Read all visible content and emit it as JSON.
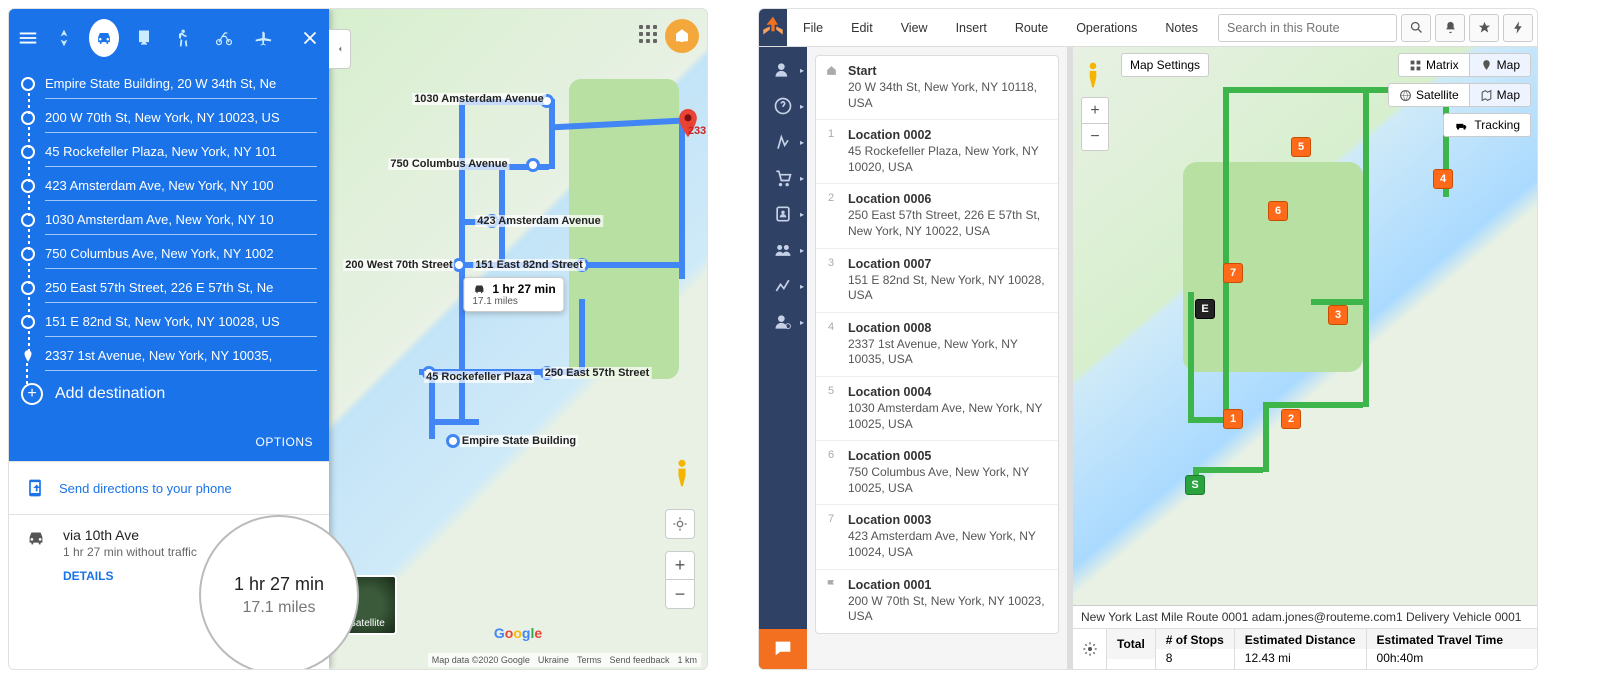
{
  "left_app": {
    "header_modes": [
      "best",
      "car",
      "transit",
      "walk",
      "bike",
      "plane"
    ],
    "active_mode": "car",
    "stops": [
      "Empire State Building, 20 W 34th St, Ne",
      "200 W 70th St, New York, NY 10023, US",
      "45 Rockefeller Plaza, New York, NY 101",
      "423 Amsterdam Ave, New York, NY 100",
      "1030 Amsterdam Ave, New York, NY 10",
      "750 Columbus Ave, New York, NY 1002",
      "250 East 57th Street, 226 E 57th St, Ne",
      "151 E 82nd St, New York, NY 10028, US",
      "2337 1st Avenue, New York, NY 10035,"
    ],
    "add_destination_label": "Add destination",
    "options_label": "OPTIONS",
    "send_label": "Send directions to your phone",
    "route_summary": {
      "via": "via 10th Ave",
      "sub": "1 hr 27 min without traffic",
      "details_label": "DETAILS",
      "time": "1 hr 27 min",
      "distance": "17.1 miles"
    },
    "map_labels": {
      "m1": "1030 Amsterdam Avenue",
      "m2": "750 Columbus Avenue",
      "m3": "423 Amsterdam Avenue",
      "m4": "200 West 70th Street",
      "m5": "151 East 82nd Street",
      "m6": "45 Rockefeller Plaza",
      "m7": "250 East 57th Street",
      "m8": "Empire State Building",
      "dest": "233",
      "tooltip_time": "1 hr 27 min",
      "tooltip_dist": "17.1 miles"
    },
    "satellite_label": "Satellite",
    "attribution": [
      "Map data ©2020 Google",
      "Ukraine",
      "Terms",
      "Send feedback",
      "1 km"
    ],
    "magnify_time": "1 hr 27 min",
    "magnify_dist": "17.1 miles"
  },
  "right_app": {
    "menu": [
      "File",
      "Edit",
      "View",
      "Insert",
      "Route",
      "Operations",
      "Notes"
    ],
    "search_placeholder": "Search in this Route",
    "map_settings_label": "Map Settings",
    "view_toggle": {
      "matrix": "Matrix",
      "map": "Map",
      "active": "map"
    },
    "layer_toggle": {
      "satellite": "Satellite",
      "map": "Map",
      "active": "map"
    },
    "tracking_label": "Tracking",
    "stops": [
      {
        "num": "",
        "icon": "home",
        "title": "Start",
        "addr": "20 W 34th St, New York, NY 10118, USA"
      },
      {
        "num": "1",
        "title": "Location 0002",
        "addr": "45 Rockefeller Plaza, New York, NY 10020, USA"
      },
      {
        "num": "2",
        "title": "Location 0006",
        "addr": "250 East 57th Street, 226 E 57th St, New York, NY 10022, USA"
      },
      {
        "num": "3",
        "title": "Location 0007",
        "addr": "151 E 82nd St, New York, NY 10028, USA"
      },
      {
        "num": "4",
        "title": "Location 0008",
        "addr": "2337 1st Avenue, New York, NY 10035, USA"
      },
      {
        "num": "5",
        "title": "Location 0004",
        "addr": "1030 Amsterdam Ave, New York, NY 10025, USA"
      },
      {
        "num": "6",
        "title": "Location 0005",
        "addr": "750 Columbus Ave, New York, NY 10025, USA"
      },
      {
        "num": "7",
        "title": "Location 0003",
        "addr": "423 Amsterdam Ave, New York, NY 10024, USA"
      },
      {
        "num": "",
        "icon": "flag",
        "title": "Location 0001",
        "addr": "200 W 70th St, New York, NY 10023, USA"
      }
    ],
    "bottom_info": "New York Last Mile Route 0001 adam.jones@routeme.com1 Delivery Vehicle 0001",
    "summary": {
      "total_label": "Total",
      "stops_label": "# of Stops",
      "stops_val": "8",
      "dist_label": "Estimated Distance",
      "dist_val": "12.43 mi",
      "time_label": "Estimated Travel Time",
      "time_val": "00h:40m"
    },
    "map_markers": {
      "s": "S",
      "e": "E",
      "n1": "1",
      "n2": "2",
      "n3": "3",
      "n4": "4",
      "n5": "5",
      "n6": "6",
      "n7": "7"
    }
  }
}
